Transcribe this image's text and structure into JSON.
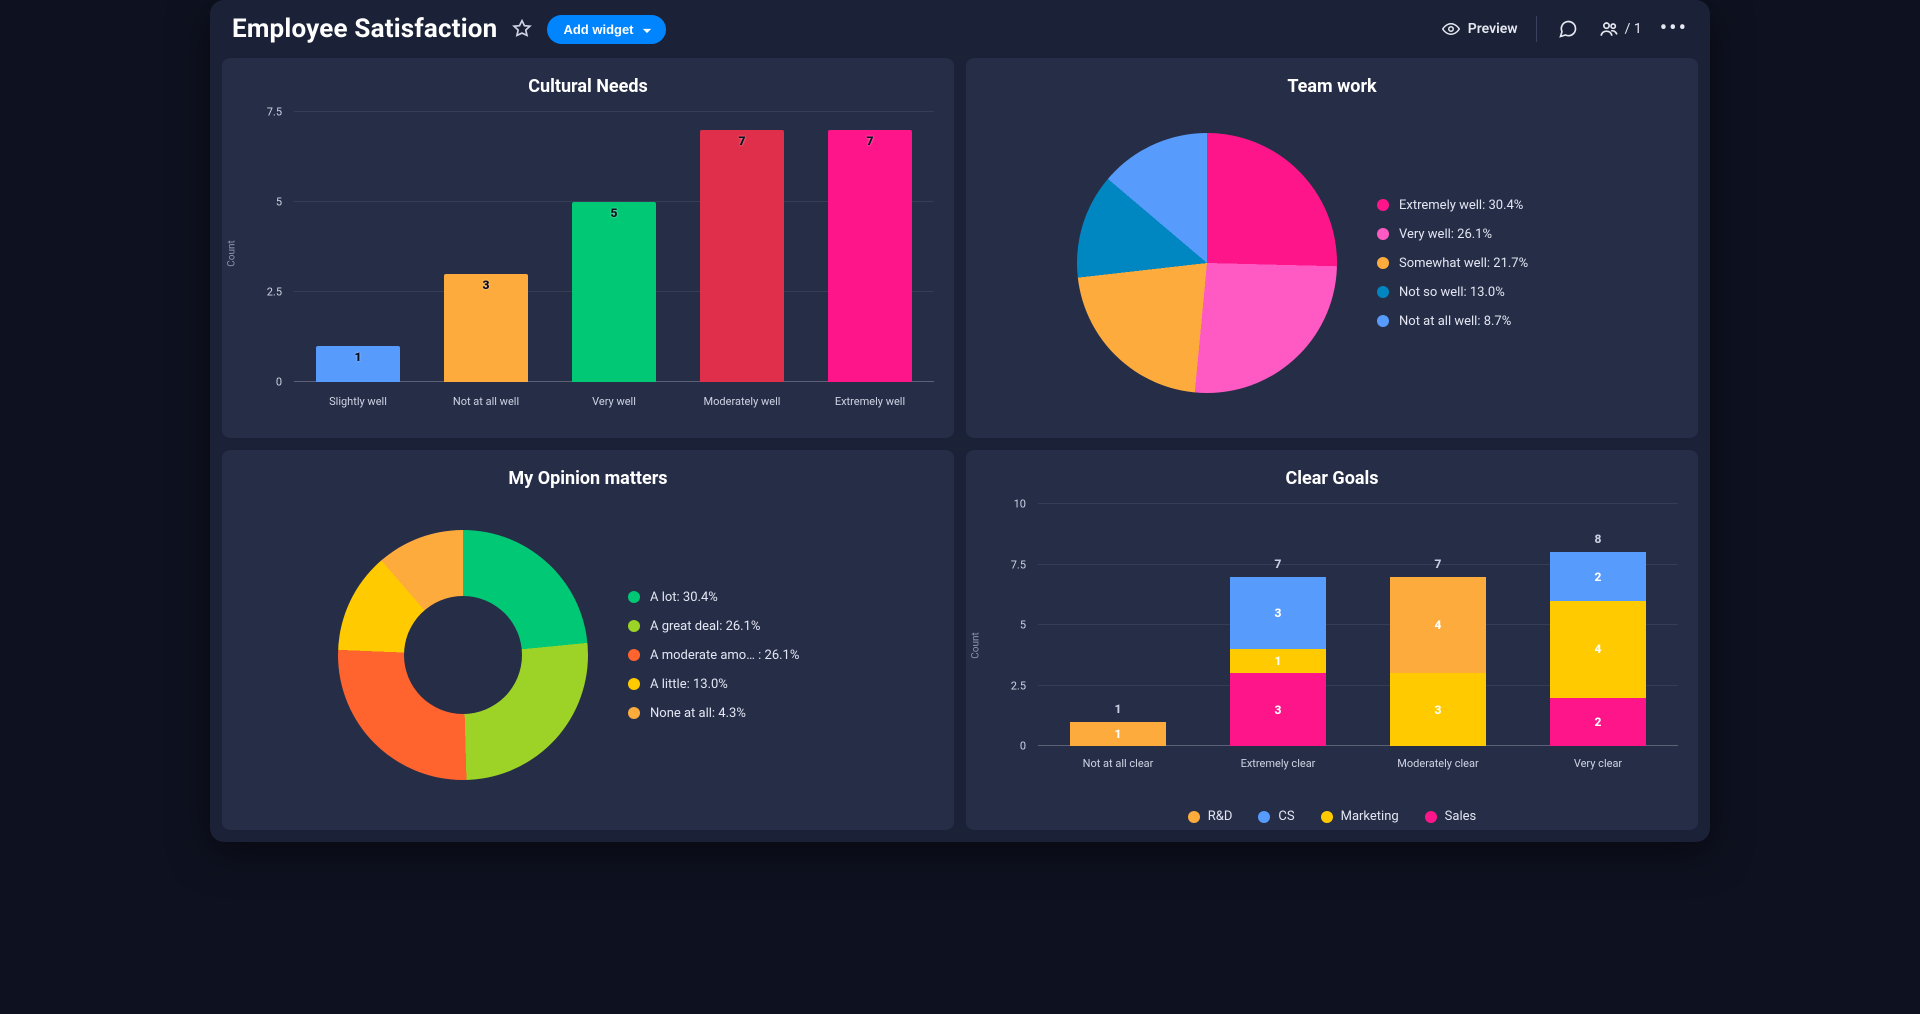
{
  "header": {
    "title": "Employee Satisfaction",
    "add_widget_label": "Add widget",
    "preview_label": "Preview",
    "people_count": "/ 1"
  },
  "colors": {
    "blue": "#579bfc",
    "orange": "#fdab3d",
    "green": "#00c875",
    "lime": "#9cd326",
    "red": "#df2f4a",
    "pink": "#ff158a",
    "hotpink": "#ff5ac4",
    "yellow": "#ffcb00",
    "teal": "#0086c0",
    "orange2": "#ff642e"
  },
  "cards": {
    "cultural_needs": {
      "title": "Cultural Needs"
    },
    "team_work": {
      "title": "Team work"
    },
    "opinion": {
      "title": "My Opinion matters"
    },
    "clear_goals": {
      "title": "Clear Goals"
    }
  },
  "chart_data": [
    {
      "id": "cultural_needs",
      "type": "bar",
      "title": "Cultural Needs",
      "ylabel": "Count",
      "ylim": [
        0,
        7.5
      ],
      "yticks": [
        0,
        2.5,
        5,
        7.5
      ],
      "categories": [
        "Slightly well",
        "Not at all well",
        "Very well",
        "Moderately well",
        "Extremely well"
      ],
      "values": [
        1,
        3,
        5,
        7,
        7
      ],
      "bar_colors": [
        "#579bfc",
        "#fdab3d",
        "#00c875",
        "#df2f4a",
        "#ff158a"
      ]
    },
    {
      "id": "team_work",
      "type": "pie",
      "title": "Team work",
      "slices": [
        {
          "label": "Extremely well",
          "pct": 30.4,
          "color": "#ff158a"
        },
        {
          "label": "Very well",
          "pct": 26.1,
          "color": "#ff5ac4"
        },
        {
          "label": "Somewhat well",
          "pct": 21.7,
          "color": "#fdab3d"
        },
        {
          "label": "Not so well",
          "pct": 13.0,
          "color": "#0086c0"
        },
        {
          "label": "Not at all well",
          "pct": 8.7,
          "color": "#579bfc"
        }
      ],
      "legend": [
        "Extremely well: 30.4%",
        "Very well: 26.1%",
        "Somewhat well: 21.7%",
        "Not so well: 13.0%",
        "Not at all well: 8.7%"
      ]
    },
    {
      "id": "opinion",
      "type": "donut",
      "title": "My Opinion matters",
      "slices": [
        {
          "label": "A lot",
          "pct": 30.4,
          "color": "#00c875"
        },
        {
          "label": "A great deal",
          "pct": 26.1,
          "color": "#9cd326"
        },
        {
          "label": "A moderate amo…",
          "pct": 26.1,
          "color": "#ff642e"
        },
        {
          "label": "A little",
          "pct": 13.0,
          "color": "#ffcb00"
        },
        {
          "label": "None at all",
          "pct": 4.3,
          "color": "#fdab3d"
        }
      ],
      "legend": [
        "A lot: 30.4%",
        "A great deal: 26.1%",
        "A moderate amo…  : 26.1%",
        "A little: 13.0%",
        "None at all: 4.3%"
      ]
    },
    {
      "id": "clear_goals",
      "type": "stacked_bar",
      "title": "Clear Goals",
      "ylabel": "Count",
      "ylim": [
        0,
        10
      ],
      "yticks": [
        0,
        2.5,
        5,
        7.5,
        10
      ],
      "categories": [
        "Not at all clear",
        "Extremely clear",
        "Moderately clear",
        "Very clear"
      ],
      "totals": [
        1,
        7,
        7,
        8
      ],
      "series": [
        {
          "name": "R&D",
          "color": "#fdab3d"
        },
        {
          "name": "CS",
          "color": "#579bfc"
        },
        {
          "name": "Marketing",
          "color": "#ffcb00"
        },
        {
          "name": "Sales",
          "color": "#ff158a"
        }
      ],
      "stacks": [
        [
          {
            "series": "R&D",
            "value": 1
          }
        ],
        [
          {
            "series": "Sales",
            "value": 3
          },
          {
            "series": "Marketing",
            "value": 1
          },
          {
            "series": "CS",
            "value": 3
          }
        ],
        [
          {
            "series": "Marketing",
            "value": 3
          },
          {
            "series": "R&D",
            "value": 4
          }
        ],
        [
          {
            "series": "Sales",
            "value": 2
          },
          {
            "series": "Marketing",
            "value": 4
          },
          {
            "series": "CS",
            "value": 2
          }
        ]
      ]
    }
  ]
}
